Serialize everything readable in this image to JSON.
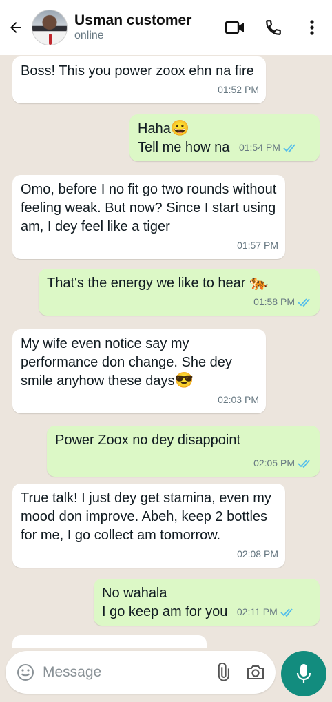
{
  "header": {
    "contact_name": "Usman customer",
    "status": "online"
  },
  "messages": [
    {
      "direction": "in",
      "text": "Boss! This you power zoox ehn na fire",
      "time": "01:52 PM"
    },
    {
      "direction": "out",
      "line1": "Haha",
      "emoji1": "😀",
      "line2": "Tell me how na",
      "time": "01:54 PM",
      "read": true
    },
    {
      "direction": "in",
      "text": "Omo, before I no fit go two rounds without feeling weak. But now? Since I start using am, I dey feel like a tiger",
      "time": "01:57 PM"
    },
    {
      "direction": "out",
      "text": "That's the energy we like to hear",
      "emoji": "🐅",
      "time": "01:58 PM",
      "read": true
    },
    {
      "direction": "in",
      "text": "My wife even notice say my performance don change. She dey smile anyhow these days",
      "emoji": "😎",
      "time": "02:03 PM"
    },
    {
      "direction": "out",
      "text": "Power Zoox no dey disappoint",
      "time": "02:05 PM",
      "read": true
    },
    {
      "direction": "in",
      "text": "True talk! I just dey get stamina, even my mood don improve. Abeh, keep 2 bottles for me, I go collect am tomorrow.",
      "time": "02:08 PM"
    },
    {
      "direction": "out",
      "line1": "No wahala",
      "line2": "I go keep am for you",
      "time": "02:11 PM",
      "read": true
    }
  ],
  "composer": {
    "placeholder": "Message"
  },
  "colors": {
    "incoming_bubble": "#ffffff",
    "outgoing_bubble": "#dcf8c6",
    "read_ticks": "#53bdeb",
    "mic_button": "#128c7e"
  },
  "icons": [
    "back-arrow-icon",
    "video-call-icon",
    "phone-icon",
    "more-vert-icon",
    "emoji-icon",
    "attach-icon",
    "camera-icon",
    "mic-icon"
  ]
}
